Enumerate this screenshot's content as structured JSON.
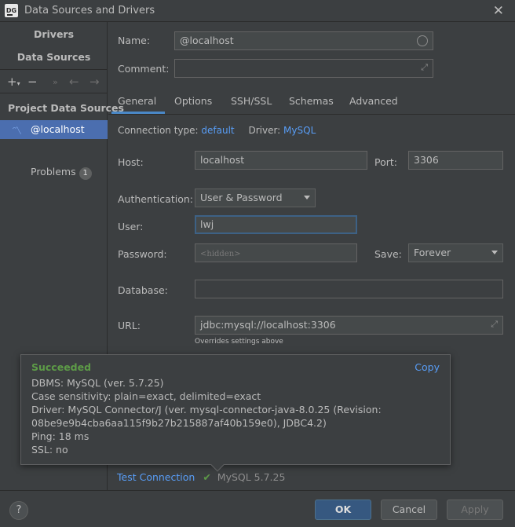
{
  "window": {
    "logo_text": "DG",
    "title": "Data Sources and Drivers"
  },
  "sidebar": {
    "tab_drivers": "Drivers",
    "tab_sources": "Data Sources",
    "project_label": "Project Data Sources",
    "selected_source": "@localhost",
    "problems_label": "Problems",
    "problems_count": "1"
  },
  "form": {
    "name_label": "Name:",
    "name_value": "@localhost",
    "comment_label": "Comment:",
    "comment_value": "",
    "tabs": [
      "General",
      "Options",
      "SSH/SSL",
      "Schemas",
      "Advanced"
    ],
    "connection_type_label": "Connection type:",
    "connection_type_value": "default",
    "driver_label": "Driver:",
    "driver_value": "MySQL",
    "host_label": "Host:",
    "host_value": "localhost",
    "port_label": "Port:",
    "port_value": "3306",
    "auth_label": "Authentication:",
    "auth_value": "User & Password",
    "user_label": "User:",
    "user_value": "lwj",
    "password_label": "Password:",
    "password_value": "<hidden>",
    "save_label": "Save:",
    "save_value": "Forever",
    "database_label": "Database:",
    "database_value": "",
    "url_label": "URL:",
    "url_value": "jdbc:mysql://localhost:3306",
    "url_hint": "Overrides settings above"
  },
  "popup": {
    "title": "Succeeded",
    "copy_label": "Copy",
    "lines": [
      "DBMS: MySQL (ver. 5.7.25)",
      "Case sensitivity: plain=exact, delimited=exact",
      "Driver: MySQL Connector/J (ver. mysql-connector-java-8.0.25 (Revision:",
      "08be9e9b4cba6aa115f9b27b215887af40b159e0), JDBC4.2)",
      "Ping: 18 ms",
      "SSL: no"
    ]
  },
  "test": {
    "link": "Test Connection",
    "check": "✔",
    "result": "MySQL 5.7.25"
  },
  "footer": {
    "help": "?",
    "ok": "OK",
    "cancel": "Cancel",
    "apply": "Apply"
  }
}
